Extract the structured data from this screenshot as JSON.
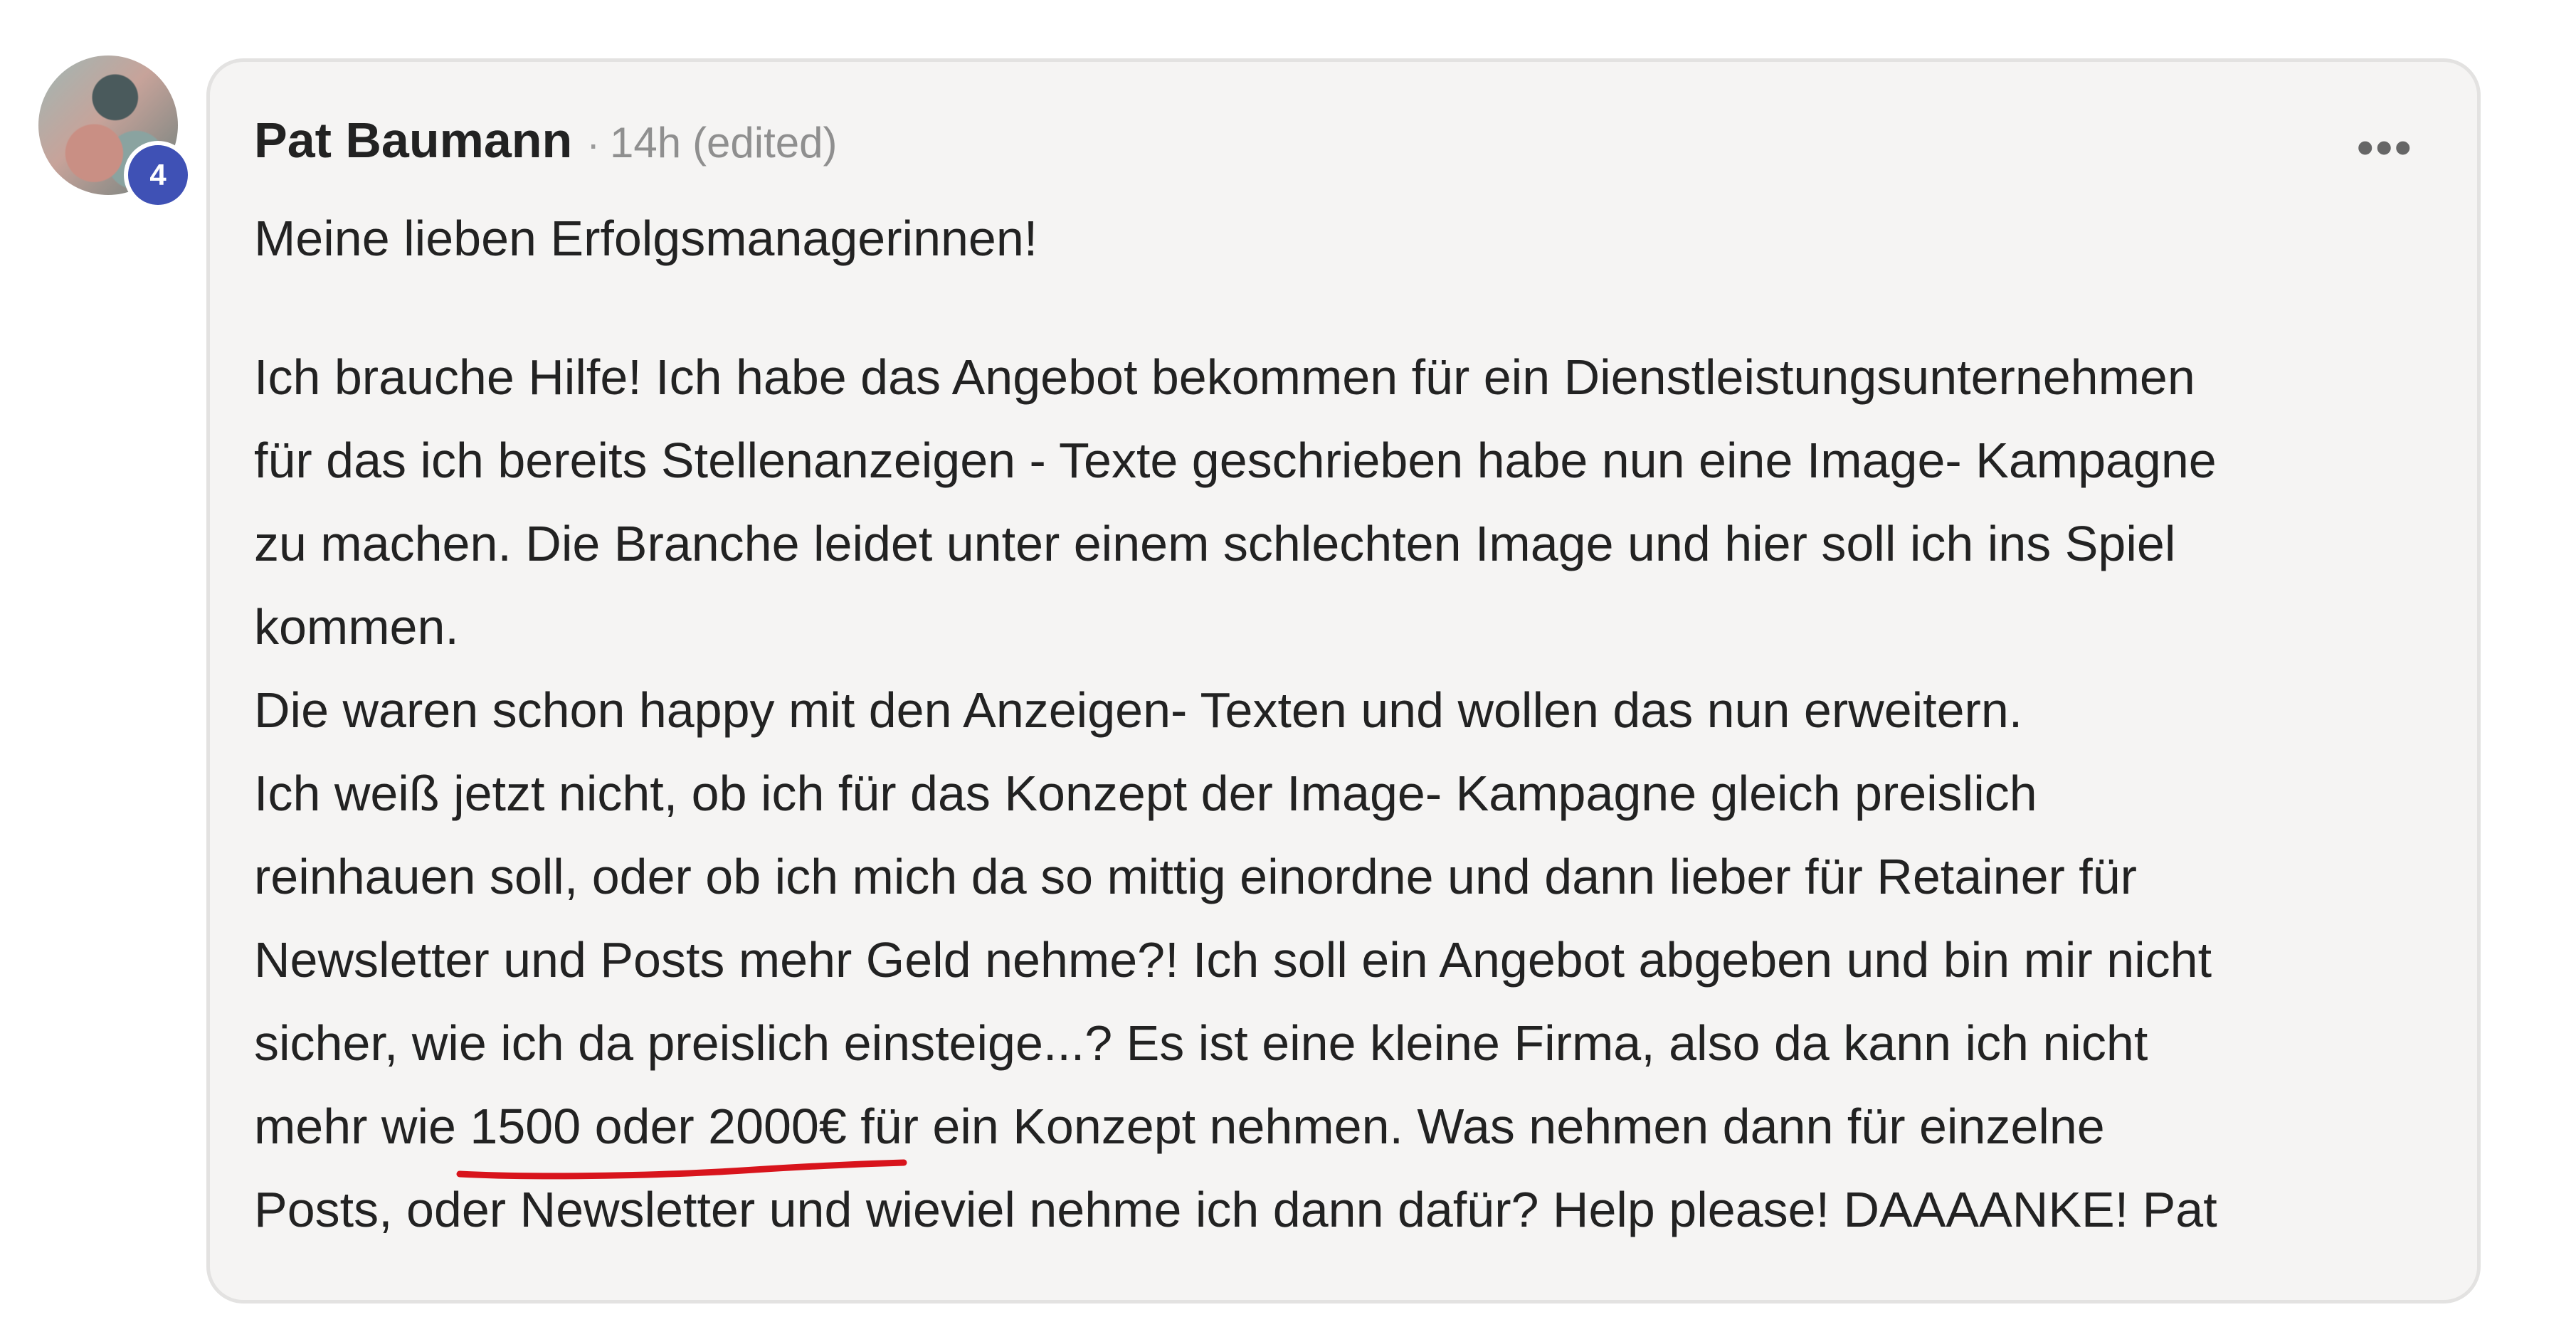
{
  "post": {
    "author": "Pat Baumann",
    "time": "14h",
    "edited_label": "(edited)",
    "separator": "·",
    "badge_count": "4",
    "menu_icon": "more-horizontal-icon",
    "greeting": "Meine lieben Erfolgsmanagerinnen!",
    "lines": [
      "Ich brauche Hilfe! Ich habe das Angebot bekommen für ein Dienstleistungsunternehmen",
      "für das ich bereits Stellenanzeigen - Texte geschrieben habe nun eine Image- Kampagne",
      "zu machen. Die Branche leidet unter einem schlechten Image und hier soll ich ins Spiel",
      "kommen.",
      "Die waren schon happy mit den Anzeigen- Texten und wollen das nun erweitern.",
      "Ich weiß jetzt nicht, ob ich für das Konzept der Image- Kampagne gleich preislich",
      "reinhauen soll, oder ob ich mich da so mittig einordne und dann lieber für Retainer für",
      "Newsletter und Posts mehr Geld nehme?! Ich soll ein Angebot abgeben und bin mir nicht",
      "sicher, wie ich da preislich einsteige...? Es ist eine kleine Firma, also da kann ich nicht"
    ],
    "price_line_before": "mehr wie ",
    "price_highlight": "1500 oder 2000€",
    "price_line_after": " für ein Konzept nehmen. Was nehmen dann für einzelne",
    "last_line": "Posts, oder Newsletter und wieviel nehme ich dann dafür? Help please! DAAAANKE! Pat"
  },
  "colors": {
    "badge": "#3f51b5",
    "card_background": "#f5f4f3",
    "underline": "#d8141c"
  }
}
